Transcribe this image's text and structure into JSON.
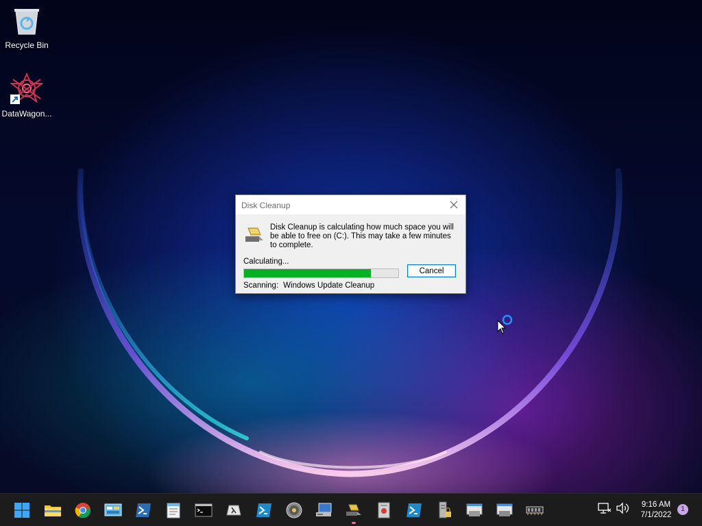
{
  "desktop": {
    "icons": [
      {
        "label": "Recycle Bin",
        "icon": "recycle-bin-icon"
      },
      {
        "label": "DataWagon...",
        "icon": "datawagon-icon"
      }
    ]
  },
  "dialog": {
    "title": "Disk Cleanup",
    "message": "Disk Cleanup is calculating how much space you will be able to free on  (C:). This may take a few minutes to complete.",
    "calculating_label": "Calculating...",
    "progress": 0.82,
    "progress_color": "#06b025",
    "cancel_label": "Cancel",
    "scanning_label": "Scanning:",
    "scanning_item": "Windows Update Cleanup"
  },
  "taskbar": {
    "apps": [
      {
        "name": "start",
        "icon": "windows-start-icon"
      },
      {
        "name": "file-explorer",
        "icon": "folder-icon"
      },
      {
        "name": "chrome",
        "icon": "chrome-icon"
      },
      {
        "name": "control-panel",
        "icon": "control-panel-icon"
      },
      {
        "name": "powershell",
        "icon": "powershell-icon"
      },
      {
        "name": "notepad",
        "icon": "notepad-icon"
      },
      {
        "name": "command-prompt",
        "icon": "terminal-icon"
      },
      {
        "name": "lambda-tool",
        "icon": "lambda-icon"
      },
      {
        "name": "powershell-2",
        "icon": "powershell-icon"
      },
      {
        "name": "disc-utility",
        "icon": "disc-icon"
      },
      {
        "name": "network-computer",
        "icon": "computer-icon"
      },
      {
        "name": "disk-cleanup",
        "icon": "disk-cleanup-icon",
        "active": true
      },
      {
        "name": "document-viewer",
        "icon": "document-icon"
      },
      {
        "name": "powershell-3",
        "icon": "powershell-icon"
      },
      {
        "name": "server-lock",
        "icon": "server-lock-icon"
      },
      {
        "name": "printer-window",
        "icon": "window-app-icon"
      },
      {
        "name": "printer-window-2",
        "icon": "window-app-icon"
      },
      {
        "name": "memory-chip",
        "icon": "memory-chip-icon"
      }
    ],
    "tray": {
      "network_icon": "network-icon",
      "volume_icon": "volume-icon"
    },
    "clock": {
      "time": "9:16 AM",
      "date": "7/1/2022"
    },
    "notification_count": "1"
  }
}
